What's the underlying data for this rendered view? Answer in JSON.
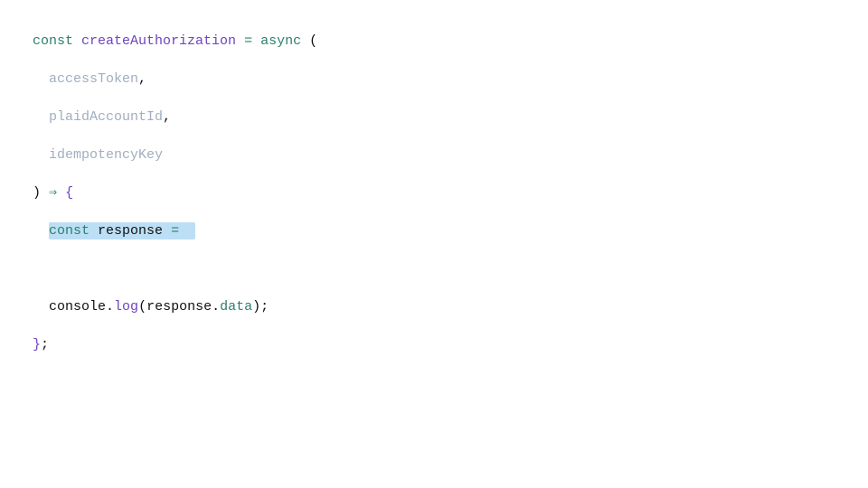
{
  "code": {
    "kw_const1": "const",
    "func_name": "createAuthorization",
    "eq1": " = ",
    "kw_async": "async",
    "open_paren": " (",
    "param1": "accessToken",
    "comma1": ",",
    "param2": "plaidAccountId",
    "comma2": ",",
    "param3": "idempotencyKey",
    "close_paren": ")",
    "arrow": " ⇒ ",
    "open_brace": "{",
    "hl_const": "const",
    "hl_sp1": " ",
    "hl_response": "response",
    "hl_sp2": " ",
    "hl_eq": "=",
    "hl_trail": "  ",
    "console_word": "console",
    "dot1": ".",
    "log_word": "log",
    "lp": "(",
    "resp2": "response",
    "dot2": ".",
    "data_word": "data",
    "rp": ")",
    "semi": ";",
    "close_brace": "}",
    "semi2": ";"
  }
}
